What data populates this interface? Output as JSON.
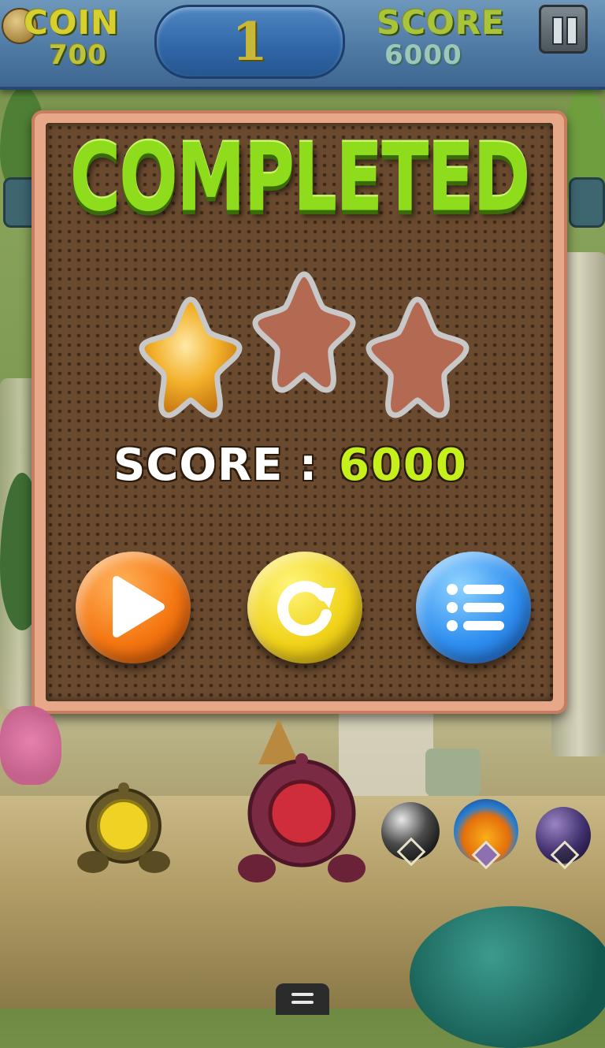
{
  "hud": {
    "coin_label": "COIN",
    "coin_value": "700",
    "level": "1",
    "score_label": "SCORE",
    "score_value": "6000",
    "pause_icon": "pause-icon"
  },
  "dialog": {
    "title": "COMPLETED",
    "stars_earned": 1,
    "stars_total": 3,
    "score_label": "SCORE :",
    "score_value": "6000",
    "buttons": [
      {
        "icon": "play-icon",
        "color": "#f47611"
      },
      {
        "icon": "replay-icon",
        "color": "#f1d31a"
      },
      {
        "icon": "menu-list-icon",
        "color": "#2f8ff0"
      }
    ]
  },
  "colors": {
    "title_green": "#8fdc1c",
    "star_gold": "#f2b02a",
    "star_empty": "#b46a52",
    "score_green": "#c6f01c"
  },
  "game": {
    "shooters": [
      "yellow-shooter-icon",
      "red-shooter-icon"
    ],
    "power_ups": [
      "black-ball-icon",
      "feather-ball-icon",
      "bomb-ball-icon"
    ]
  }
}
